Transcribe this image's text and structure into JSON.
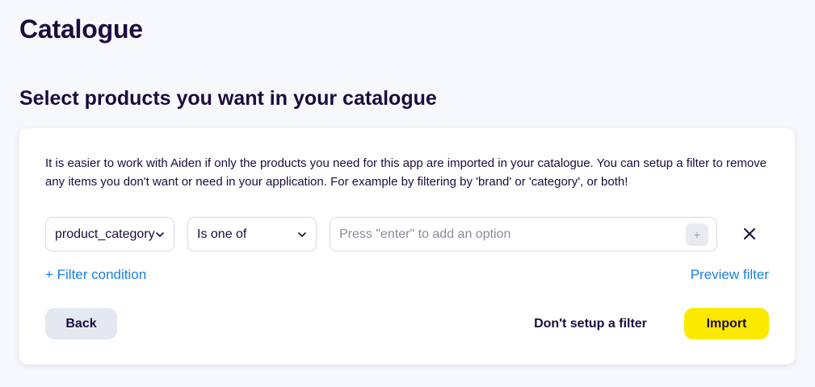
{
  "page": {
    "title": "Catalogue",
    "section_title": "Select products you want in your catalogue"
  },
  "card": {
    "description": "It is easier to work with Aiden if only the products you need for this app are imported in your catalogue. You can setup a filter to remove any items you don't want or need in your application. For example by filtering by 'brand' or 'category', or both!"
  },
  "filter": {
    "field_value": "product_category",
    "operator_value": "Is one of",
    "option_placeholder": "Press \"enter\" to add an option",
    "add_option_label": "+",
    "icons": {
      "field_chevron": "chevron-down-icon",
      "operator_chevron": "chevron-down-icon",
      "remove": "close-icon"
    }
  },
  "links": {
    "add_condition": "+ Filter condition",
    "preview": "Preview filter"
  },
  "actions": {
    "back": "Back",
    "skip": "Don't setup a filter",
    "import": "Import"
  },
  "colors": {
    "text": "#1c0c3f",
    "link": "#1a7fe0",
    "primary": "#fbe900",
    "secondary": "#e4e8f0",
    "background": "#f7f8fb"
  }
}
